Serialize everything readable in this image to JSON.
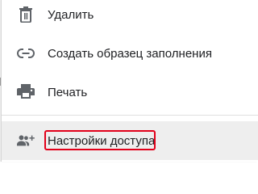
{
  "menu": {
    "items": [
      {
        "id": "delete",
        "label": "Удалить",
        "icon": "trash-icon"
      },
      {
        "id": "template",
        "label": "Создать образец заполнения",
        "icon": "link-icon"
      },
      {
        "id": "print",
        "label": "Печать",
        "icon": "printer-icon"
      },
      {
        "id": "access",
        "label": "Настройки доступа",
        "icon": "add-people-icon",
        "highlighted": true
      }
    ]
  },
  "colors": {
    "text": "#202124",
    "icon": "#5f6368",
    "hover_background": "#eeeeee",
    "highlight_border": "#e2001a"
  }
}
